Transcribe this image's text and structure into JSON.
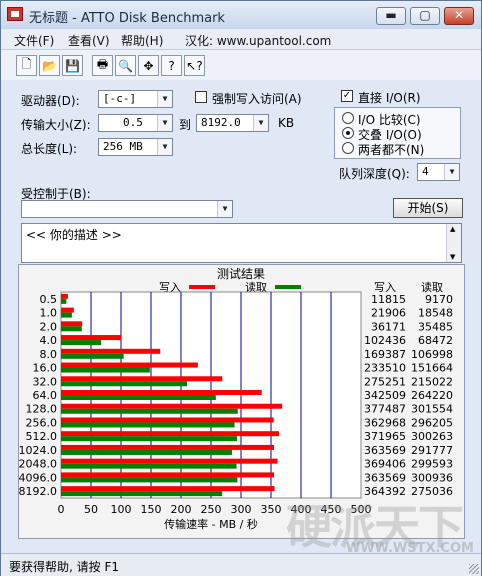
{
  "window": {
    "title": "无标题 - ATTO Disk Benchmark",
    "minimize": "▬",
    "maximize": "▢",
    "close": "✕"
  },
  "menu": {
    "file": "文件(F)",
    "view": "查看(V)",
    "help": "帮助(H)",
    "localized": "汉化: www.upantool.com"
  },
  "toolbar": {
    "icons": [
      "new-icon",
      "open-icon",
      "save-icon",
      "print-icon",
      "print-preview-icon",
      "move-icon",
      "help-icon",
      "context-help-icon"
    ],
    "glyphs": [
      "🗋",
      "📂",
      "💾",
      "🖶",
      "🔍",
      "✥",
      "?",
      "↖?"
    ]
  },
  "form": {
    "drive_label": "驱动器(D):",
    "drive_value": "[-c-]",
    "transfer_label": "传输大小(Z):",
    "transfer_from": "0.5",
    "to_label": "到",
    "transfer_to": "8192.0",
    "transfer_unit": "KB",
    "length_label": "总长度(L):",
    "length_value": "256 MB",
    "force_write_label": "强制写入访问(A)",
    "direct_io_label": "直接 I/O(R)",
    "direct_io_checked": "✓",
    "io_compare_label": "I/O 比较(C)",
    "overlap_io_label": "交叠 I/O(O)",
    "neither_label": "两者都不(N)",
    "queue_label": "队列深度(Q):",
    "queue_value": "4",
    "controlled_by_label": "受控制于(B):",
    "controlled_by_value": "",
    "start_button": "开始(S)",
    "description": "<<  你的描述  >>"
  },
  "status": {
    "text": "要获得帮助, 请按 F1"
  },
  "watermark": {
    "big": "硬派天下",
    "small": "WWW.WSTX.COM"
  },
  "colors": {
    "write": "#ff0000",
    "read": "#008000",
    "grid": "#0000a0"
  },
  "chart_data": {
    "type": "bar",
    "title": "测试结果",
    "legend": {
      "write": "写入",
      "read": "读取"
    },
    "col_write": "写入",
    "col_read": "读取",
    "xlabel": "传输速率 - MB / 秒",
    "xlim": [
      0,
      500
    ],
    "xticks": [
      "0",
      "50",
      "100",
      "150",
      "200",
      "250",
      "300",
      "350",
      "400",
      "450",
      "500"
    ],
    "categories": [
      "0.5",
      "1.0",
      "2.0",
      "4.0",
      "8.0",
      "16.0",
      "32.0",
      "64.0",
      "128.0",
      "256.0",
      "512.0",
      "1024.0",
      "2048.0",
      "4096.0",
      "8192.0"
    ],
    "series": [
      {
        "name": "写入",
        "values": [
          11815,
          21906,
          36171,
          102436,
          169387,
          233510,
          275251,
          342509,
          377487,
          362968,
          371965,
          363569,
          369406,
          363569,
          364392
        ]
      },
      {
        "name": "读取",
        "values": [
          9170,
          18548,
          35485,
          68472,
          106998,
          151664,
          215022,
          264220,
          301554,
          296205,
          300263,
          291777,
          299593,
          300936,
          275036
        ]
      }
    ]
  }
}
